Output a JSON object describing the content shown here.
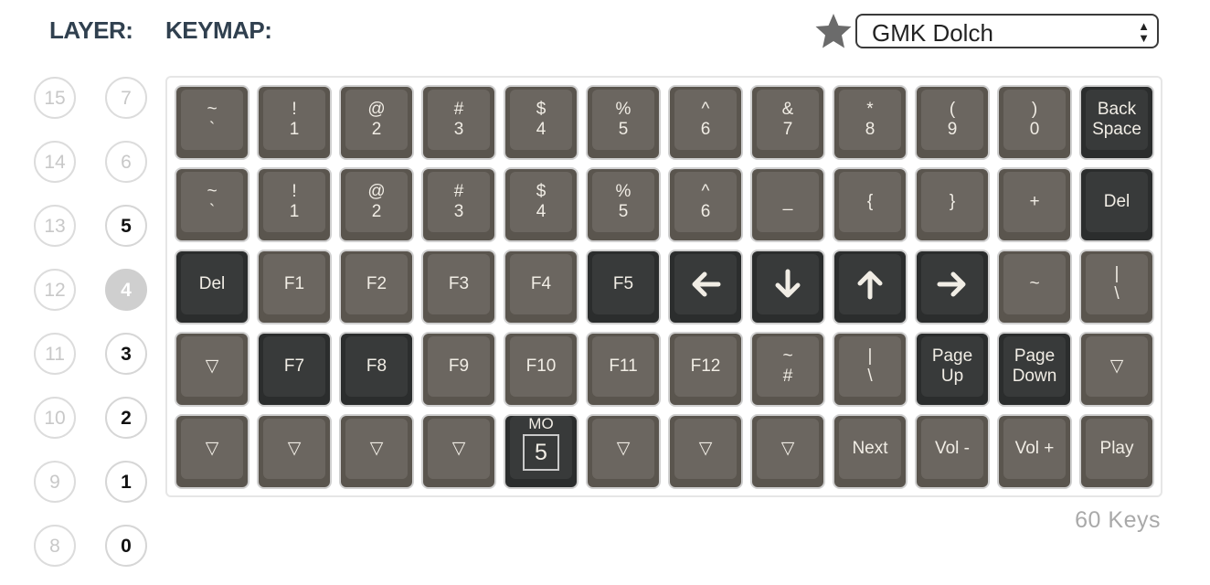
{
  "header": {
    "layer_label": "LAYER:",
    "keymap_label": "KEYMAP:",
    "favorite_icon": "star-icon",
    "keyset_select": {
      "value": "GMK Dolch"
    }
  },
  "layers": [
    {
      "label": "15",
      "state": "inactive"
    },
    {
      "label": "7",
      "state": "inactive"
    },
    {
      "label": "14",
      "state": "inactive"
    },
    {
      "label": "6",
      "state": "inactive"
    },
    {
      "label": "13",
      "state": "inactive"
    },
    {
      "label": "5",
      "state": "active"
    },
    {
      "label": "12",
      "state": "inactive"
    },
    {
      "label": "4",
      "state": "selected"
    },
    {
      "label": "11",
      "state": "inactive"
    },
    {
      "label": "3",
      "state": "active"
    },
    {
      "label": "10",
      "state": "inactive"
    },
    {
      "label": "2",
      "state": "active"
    },
    {
      "label": "9",
      "state": "inactive"
    },
    {
      "label": "1",
      "state": "active"
    },
    {
      "label": "8",
      "state": "inactive"
    },
    {
      "label": "0",
      "state": "active"
    }
  ],
  "colors": {
    "light_keycap": "#6b6660",
    "dark_keycap": "#383a3a",
    "legend": "#f1ede5"
  },
  "keyboard": {
    "rows": [
      [
        {
          "l": [
            "~",
            "`"
          ],
          "c": "lt"
        },
        {
          "l": [
            "!",
            "1"
          ],
          "c": "lt"
        },
        {
          "l": [
            "@",
            "2"
          ],
          "c": "lt"
        },
        {
          "l": [
            "#",
            "3"
          ],
          "c": "lt"
        },
        {
          "l": [
            "$",
            "4"
          ],
          "c": "lt"
        },
        {
          "l": [
            "%",
            "5"
          ],
          "c": "lt"
        },
        {
          "l": [
            "^",
            "6"
          ],
          "c": "lt"
        },
        {
          "l": [
            "&",
            "7"
          ],
          "c": "lt"
        },
        {
          "l": [
            "*",
            "8"
          ],
          "c": "lt"
        },
        {
          "l": [
            "(",
            "9"
          ],
          "c": "lt"
        },
        {
          "l": [
            ")",
            "0"
          ],
          "c": "lt"
        },
        {
          "l": [
            "Back",
            "Space"
          ],
          "c": "dk"
        }
      ],
      [
        {
          "l": [
            "~",
            "`"
          ],
          "c": "lt"
        },
        {
          "l": [
            "!",
            "1"
          ],
          "c": "lt"
        },
        {
          "l": [
            "@",
            "2"
          ],
          "c": "lt"
        },
        {
          "l": [
            "#",
            "3"
          ],
          "c": "lt"
        },
        {
          "l": [
            "$",
            "4"
          ],
          "c": "lt"
        },
        {
          "l": [
            "%",
            "5"
          ],
          "c": "lt"
        },
        {
          "l": [
            "^",
            "6"
          ],
          "c": "lt"
        },
        {
          "l": [
            "_"
          ],
          "c": "lt"
        },
        {
          "l": [
            "{"
          ],
          "c": "lt"
        },
        {
          "l": [
            "}"
          ],
          "c": "lt"
        },
        {
          "l": [
            "+"
          ],
          "c": "lt"
        },
        {
          "l": [
            "Del"
          ],
          "c": "dk"
        }
      ],
      [
        {
          "l": [
            "Del"
          ],
          "c": "dk"
        },
        {
          "l": [
            "F1"
          ],
          "c": "lt"
        },
        {
          "l": [
            "F2"
          ],
          "c": "lt"
        },
        {
          "l": [
            "F3"
          ],
          "c": "lt"
        },
        {
          "l": [
            "F4"
          ],
          "c": "lt"
        },
        {
          "l": [
            "F5"
          ],
          "c": "dk"
        },
        {
          "icon": "arrow-left-icon",
          "c": "dk"
        },
        {
          "icon": "arrow-down-icon",
          "c": "dk"
        },
        {
          "icon": "arrow-up-icon",
          "c": "dk"
        },
        {
          "icon": "arrow-right-icon",
          "c": "dk"
        },
        {
          "l": [
            "~"
          ],
          "c": "lt"
        },
        {
          "l": [
            "|",
            "\\"
          ],
          "c": "lt"
        }
      ],
      [
        {
          "l": [
            "▽"
          ],
          "c": "lt"
        },
        {
          "l": [
            "F7"
          ],
          "c": "dk"
        },
        {
          "l": [
            "F8"
          ],
          "c": "dk"
        },
        {
          "l": [
            "F9"
          ],
          "c": "lt"
        },
        {
          "l": [
            "F10"
          ],
          "c": "lt"
        },
        {
          "l": [
            "F11"
          ],
          "c": "lt"
        },
        {
          "l": [
            "F12"
          ],
          "c": "lt"
        },
        {
          "l": [
            "~",
            "#"
          ],
          "c": "lt"
        },
        {
          "l": [
            "|",
            "\\"
          ],
          "c": "lt"
        },
        {
          "l": [
            "Page",
            "Up"
          ],
          "c": "dk"
        },
        {
          "l": [
            "Page",
            "Down"
          ],
          "c": "dk"
        },
        {
          "l": [
            "▽"
          ],
          "c": "lt"
        }
      ],
      [
        {
          "l": [
            "▽"
          ],
          "c": "lt"
        },
        {
          "l": [
            "▽"
          ],
          "c": "lt"
        },
        {
          "l": [
            "▽"
          ],
          "c": "lt"
        },
        {
          "l": [
            "▽"
          ],
          "c": "lt"
        },
        {
          "mo": [
            "MO",
            "5"
          ],
          "c": "dk"
        },
        {
          "l": [
            "▽"
          ],
          "c": "lt"
        },
        {
          "l": [
            "▽"
          ],
          "c": "lt"
        },
        {
          "l": [
            "▽"
          ],
          "c": "lt"
        },
        {
          "l": [
            "Next"
          ],
          "c": "lt"
        },
        {
          "l": [
            "Vol -"
          ],
          "c": "lt"
        },
        {
          "l": [
            "Vol +"
          ],
          "c": "lt"
        },
        {
          "l": [
            "Play"
          ],
          "c": "lt"
        }
      ]
    ],
    "key_count": "60 Keys"
  }
}
